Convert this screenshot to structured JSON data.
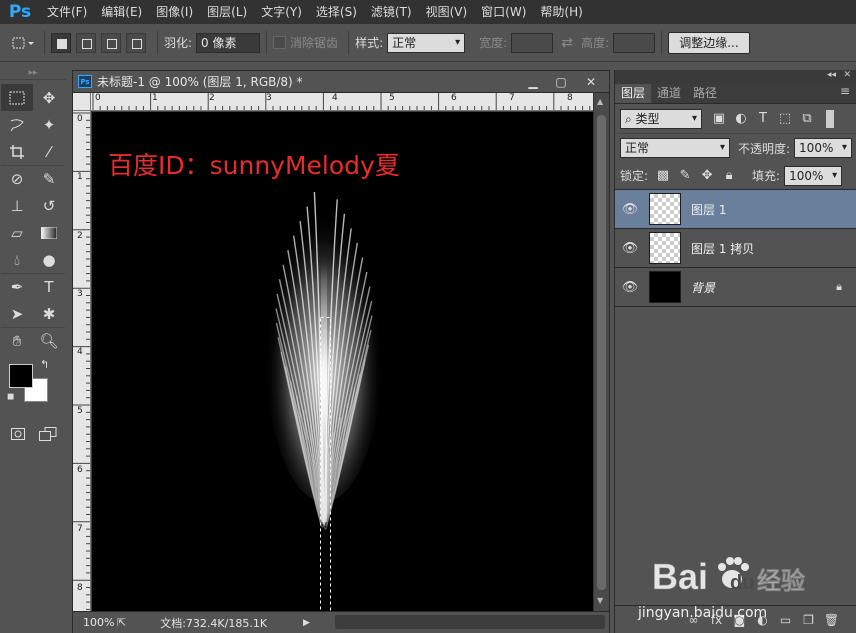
{
  "app": {
    "logo": "Ps"
  },
  "menu": [
    "文件(F)",
    "编辑(E)",
    "图像(I)",
    "图层(L)",
    "文字(Y)",
    "选择(S)",
    "滤镜(T)",
    "视图(V)",
    "窗口(W)",
    "帮助(H)"
  ],
  "options": {
    "feather_label": "羽化:",
    "feather_value": "0 像素",
    "antialias_label": "消除锯齿",
    "style_label": "样式:",
    "style_value": "正常",
    "width_label": "宽度:",
    "height_label": "高度:",
    "refine_edge_button": "调整边缘..."
  },
  "document": {
    "title": "未标题-1 @ 100% (图层 1, RGB/8) *",
    "ruler_top": [
      "0",
      "1",
      "2",
      "3",
      "4",
      "5",
      "6",
      "7",
      "8"
    ],
    "ruler_left": [
      "0",
      "1",
      "2",
      "3",
      "4",
      "5",
      "6",
      "7",
      "8"
    ],
    "canvas_text": "百度ID：sunnyMelody夏",
    "zoom": "100%",
    "doc_info": "文档:732.4K/185.1K"
  },
  "layers_panel": {
    "tabs": [
      "图层",
      "通道",
      "路径"
    ],
    "filter_label": "类型",
    "blend_mode": "正常",
    "opacity_label": "不透明度:",
    "opacity_value": "100%",
    "lock_label": "锁定:",
    "fill_label": "填充:",
    "fill_value": "100%",
    "layers": [
      {
        "name": "图层 1",
        "selected": true,
        "thumb": "transparent"
      },
      {
        "name": "图层 1 拷贝",
        "selected": false,
        "thumb": "transparent"
      },
      {
        "name": "背景",
        "selected": false,
        "thumb": "black",
        "locked": true
      }
    ]
  },
  "watermark": {
    "site": "jingyan.baidu.com",
    "brand": "Bai",
    "brand2": "du",
    "product": "经验"
  },
  "colors": {
    "foreground": "#000000",
    "background": "#ffffff",
    "canvas_text": "#e82c2c",
    "selected_layer": "#6a7f9c"
  }
}
